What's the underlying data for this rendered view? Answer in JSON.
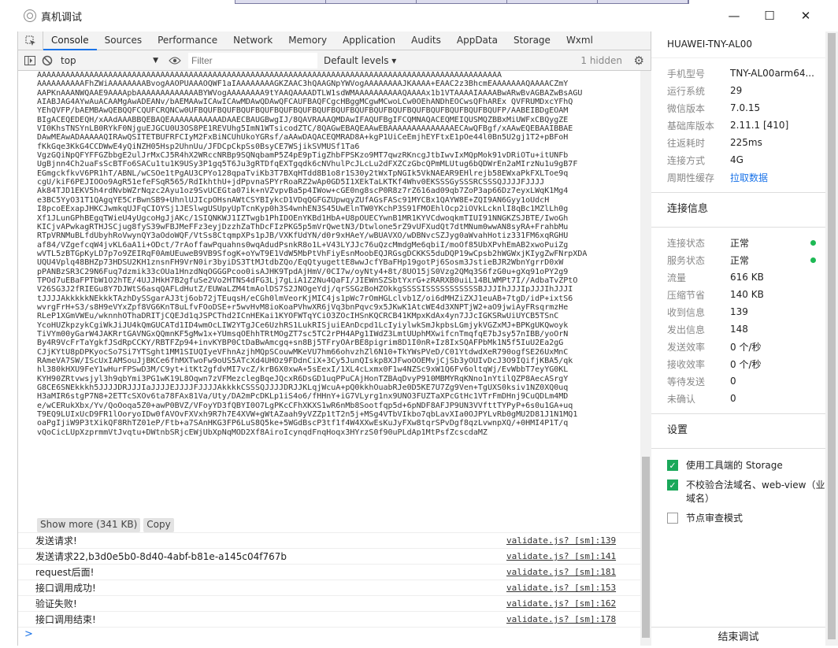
{
  "window": {
    "title": "真机调试",
    "minimize": "—",
    "maximize": "☐",
    "close": "✕"
  },
  "tabs": [
    "Console",
    "Sources",
    "Performance",
    "Network",
    "Memory",
    "Application",
    "Audits",
    "AppData",
    "Storage",
    "Wxml"
  ],
  "toolbar": {
    "context": "top",
    "filter_placeholder": "Filter",
    "levels": "Default levels ▾",
    "hidden": "1 hidden"
  },
  "blob": {
    "lines": [
      "AAAAAAAAAAAAAAAAAAAAAAAAAAAAAAAAAAAAAAAAAAAAAAAAAAAAAAAAAAAAAAAAAAAAAAAAAAAAAAAAAAAAAAAAAAAAAAAAAA",
      "AAAAAAAAAAFhZWiAAAAAAAABvogAAOPUAAAOQWF1aIAAAAAAAAGKZAAC3hQAAGNpYWVogAAAAAAAAJKAAAA+EAAC2z3BhcmEAAAAAAAQAAAACZmY",
      "AAPKnAAANWQAAE9AAAApbAAAAAAAAAAAAABYWVogAAAAAAAA9tYAAQAAAADTLW1sdWMAAAAAAAAAAQAAAAx1b1VTAAAAIAAAABwARwBvAGBAZwBsAGU",
      "AIABJAG4AYwAuACAAMgAwADEANv/bAEMAAwICAwICAwMDAwQDAwQFCAUFBAQFCgcHBggMCgwMCwoLCw0OEhANDhEOCwsQFhAREx QVFRUMDxcYFhQ",
      "YEhQVFP/bAEMBAwQEBQQFCQUFCRQNCw0UFBQUFBQUFBQUFBQUFBQUFBQUFBQUFBQUFBQUFBQUFBQUFBQUFBQUFBQUFBQUFBQUFP/AABEIBDgEOAM",
      "BIgACEQEDEQH/xAAdAAABBQEBAQEAAAAAAAAAAADAAECBAUGBwgIJ/8QAVRAAAQMDAwIFAQUFBgIFCQMNAQACEQMEIQUSMQZBBxMiUWFxCBQygZE",
      "VI0KhsTNSYnLB0RYkF0NjguEJGCU0U3OS8PE1REVUhg5ImN1WTsicodZTC/8QAGwEBAQEAAwEBAAAAAAAAAAAAAAECAwQFBgf/xAAwEQEBAAIBBAE",
      "DAwMEAwADAAAAAQIRAwQSITETBUFRFCIyM2FxBiNCUhUkoYGRsf/aAAwDAQACEQMRAD8A+kgP1UiCeEmjhEYFtxE1pOe44l0Bn5U2gj1T2+pBFoH",
      "fKkGqe3KkG4CCDWwE4yQiNZH05Hsp2UhnUu/JFDCpCkpSs0BsyCE7WSjikSVMUSf1Ta6",
      "VgzGQiNpQFYFFGZbbgE2ulJrMxCJ5R4hX2WRccNRBp9SQNqbamP5Z4pE9pTigZhbFPSKzo9MT7qwzRKncgJtbIwvIxMQpMok91vDRiOTu+itUNFb",
      "UgBjnn4Ch2uaFsScBTFo6SACu1tu1K9USy3P1gq5T6Ju3gRTDfqEXTgqdk6cNVhulPcJLcLu2dFXZCzGbcQPmMLUtug6bQDWrEn2aMIrzNu1u9gB7F",
      "EGmgckfkvV6PR1hT/ABNL/wCSOe1tPgAU3CPYo128qpaTviKb3T7BXqHTdd8B1o8r1S30y2tWxTpNGIk5VkNAEAR9EHlrejb58EWxaPkFXLToe9q",
      "cgU/kiF6PEJIOOo9AgR51efeFSqR565/RdIkhthU+jdPpvnaSPYrRoaRZ2wAp0GD5I1XEkTaLKTKf4Whv0EKSSSGySSSRCSSSQJJJJFJJJJ",
      "Ak84TJD1EKV5h4rdNvbWZrNqzc2Ayu1oz9SvUCEGta07ik+nVZvpvBa5p4IWow+cGE0ng8scP0R8z7rZ616ad09qb7ZoP3ap66Dz7eyxLWqK1Mg4",
      "e3BC5YyO31T1QAgqYE5CrBwnSB9+UhnlUJIcpOHsnAWtCSYBIykcD1VDqQGFGZUpwqyZUfAGsFASc91MYCBx1QAYW8E+ZQI9AN6Gyy1oUdcH",
      "I8pcoEExapJHKCJwmkqUJFqCIOYSj1JESlwgUSUpyUpTcnKyp0h3S4wnhEN3S45UwElnTW0YKchP3S91FMOEhlOcp2iOVkLcknlI8qBc1MZlLh0g",
      "Xf1JLunGPhBEgqTWieU4yUgcoHgJjAKc/1SIQNKWJ1IZTwgb1PhIDOEnYKBd1HbA+U8pOUECYwnB1MR1KYVCdwoqkmTIUI91NNGKZSJBTE/IwoGh",
      "KICjvAPwkagRTHJSCjug8fyS39wFBJMeFFz3eyjDzzhZaThDcFIzPKG5p5mVrQwetN3/Dtwlone5rZ9vUFXudQt7dtMNum0wwAN8syRA+FrahbMu",
      "RTpVRNMuBLfdUbyhRoVwynQY3aOdoWQF/VtSs8CtqmpXPs1pJB/VXKfUdYN/d0r9xHAeY/wBUAVXO/wDBNvcSZJyg0aWvahHotiz331FM6xqRGHU",
      "af84/VZgefcqW4jvKL6aA1i+ODct/7rAoffawPquahns0wqAdudPsnkR8o1L+V43LYJJc76uQzcMmdgMe6qbiI/moOf85UbXPvhEmAB2xwoPuiZg",
      "wVTL5zBTGpKyLD7p7o9ZEIRqF0AmUEuweB9VB9SfogK+oYwT9E1VdW5MbPtVhFiyEsnMoobEQJRGsgDCKKS5duDQP19wCpsb2hWGWxjKIygZwFNrpXDA",
      "UQU4Vplq48BHZp73HDSU2KH1znsnFH9VrN0ir3byiDS3TtMJtdbZQo/EqQtyugettE8wwJcfYBaFHp19gotPj6Sosm3JstieBJR2WbnYgrrD0xW",
      "pPANBzSR3C29N6Fuq7dzmik33cOUa1HnzdNqOGGGPcoo0isAJHK9TpdAjHmV/0CI7w/oyNty4+8t/8UO15jS0Vzg2QMq3S6fzG0u+gXq91oPY2g9",
      "TPOd7uEBaFPTbW1O2hTE/4UJJHkH7B2gfuSe2Vo2HTNS4dFG3Lj7gLiA1Z2Nu4QaFI/JIEWnSZSbtYxrG+zRARXB0uiL14BLWMPt7I//AdbaTvZPtO",
      "V26SG3J2fRIEGu8Y7DJWtS6asqQAFLdHutZ/EUWaLZM4tmAolDS7S2JNOgeYdj/qrSSGzBoHZOkkgSSSSISSSSSSSSSSSBJJJIhJJJIpJJJIhJJJI",
      "tJJJJAkkkkkNEkkkTAzhDySSgarAJ3tj6ob72jTEuqsH/eCGh0lmVeorKjMIC4js1pWc7rOmHGLclvb1Z/oi6dMHZiZXJ1euAB+7tgD/idP+ixtS6",
      "wvrgFrH+S3/s8H9eVYxZpf8VG6KnT8uLfvFOoDSE+r5wvHvM8ioKoaPVhwXR6jVq3bnPqvc9x5JKwK1AtcWE4d3XNPTjW2+aO9jwiAyFRsqrmzHe",
      "RLeP1XGmVWEu/wknnhOThaDRITjCQEJd1qJSPCThd2ICnHEKai1KYOFWTqYCiO3ZOcIHSnKQCRCB41KMpxKdAx4yn7JJcIGKSRwUiUYCB5TSnC",
      "YcoHUZkpzykCgiWkJiJU4kQmGUCATd1ID4wmOcLIW2YTgJCe6UzhRS1LukRISjuiEAnDcpd1LcIyiylwkSmJkpbsLGmjykVGZxMJ+BPKgUKQwoyk",
      "TiVYm00yGarW4JAKRrtGAVNGxQQmnKF5gMw1x+YUmsqOEhhTRtMOgZT7sc5TC2rPH4APg1IWdZ3LmtUUphMXwifcnTmqfqE7bJsy57nIBB/yoOrN",
      "By4R9VcFrTaYgkfJSdRpCCKY/RBTFZp94+invKYBP0CtDaBwAmcgq+sn8Bj5TFryOArBE8pigrim8D1I0nR+Iz8IxSQAFPbMk1N5f5IuU2Ea2gG",
      "CJjKYtU8pDPKyocSo7Si7YTSght1MM1SIUQIyeVFhnAzjhMQpSCouwMKeVU7hm66ohvzhZl6N10+TkYWsPVeD/C01YtdwdXeR790ogfSE26UxMnC",
      "RAmeVA7SW/IScUxIAMSouJjBKCe6fhMXTwoFw9oUS5ATcXd4UHOz9FDdnCiX+3Cy5JunQIskp8XJFwoOOEMvjCjSb3yOUIvDcJ3O9IQifjKBA5/qk",
      "hl380kHXU9FeY1wHurFPSwD3M/C9yt+itKt2gfdvMI7vcZ/krB6X0xwA+5sEexI/1XL4cLxmx0F1w4NZSc9xW1Q6Fv6oltqWj/EvWbbT7eyYG0KL",
      "KYH90ZRtvwsjyl3h9qbYmi3PG1wK19L8Oqwn7zVFMezclegBqeJQcxR6DsGD1uqPPuCAjHonTZBAqDvyP910MBMYRqKNno1nYtilQZP8AecASrgY",
      "G8CE6SNEkkkh5JJJJDRJJJIaJJJJEJJJJFJJJJAkkkkCSSSQJJJJDRJJKLqjWcuA+pQ0kkhOuabRJe0D5KE7U7Zg9Ven+TgUXS0ksiv1NZ0XQ0uq",
      "H3aMIR6stgP7N8+2ETTcSXOv6ta78FAx81Va/Uty/DA2mPcDKLp1iS4o6/fHHnY+iG7VLyrg1nx9UNO3FUZTaXPcGtHc1VTrFmDHnj9CuQDLm4MD",
      "e/wCERukXbx/Yv/QoOoqa5Z0+awP0BVZ/VFoyYD3fQBYI0O7LgPKcCFhXKXS1wR6nMb8Sootfqp5d+6pNDF8AFJP9UN3VVfttTYPyP+6s0u1GA+uq",
      "T9EQ9LUIxUcD9FR1lOoryoIDw0fAVOvFXVxh9R7h7E4XVW+gWtAZaah9yVZZp1tT2n5j+MSg4VTbVIkbo7qbLavXIa0OJPYLvRb0gMU2D81J1N1MQ1",
      "oaPgIjiW9P3tXikQF8RhTZ01eP/Ftb+a7SAnHKG3FP6LuS8Q5ke+5WGdBscP3tf1f4W4XXwEsKuJyFXw8tqrSPvDgf8qzLvwnpXQ/+0HMI4P1T/q",
      "vQoCicLUpXzprmmVtJvqtu+DWtnbSRjcEWjUbXpNqMOD2Xf8AiroIcynqdFnqHoqx3HYrzS0f90uPLdAp1MtPsfZcscdaMZ"
    ],
    "show_more": "Show more (341 KB)",
    "copy": "Copy"
  },
  "logs": [
    {
      "msg": "发送请求!",
      "src": "validate.js? [sm]:139"
    },
    {
      "msg": "发送请求22,b3d0e5b0-8d40-4abf-b81e-a145c04f767b",
      "src": "validate.js? [sm]:141"
    },
    {
      "msg": "request后面!",
      "src": "validate.js? [sm]:181"
    },
    {
      "msg": "接口调用成功!",
      "src": "validate.js? [sm]:153"
    },
    {
      "msg": "验证失败!",
      "src": "validate.js? [sm]:162"
    },
    {
      "msg": "接口调用结束!",
      "src": "validate.js? [sm]:178"
    }
  ],
  "prompt": ">",
  "panel": {
    "device": "HUAWEI-TNY-AL00",
    "info": [
      {
        "k": "手机型号",
        "v": "TNY-AL00arm64..."
      },
      {
        "k": "运行系统",
        "v": "29"
      },
      {
        "k": "微信版本",
        "v": "7.0.15"
      },
      {
        "k": "基础库版本",
        "v": "2.11.1 [410]"
      },
      {
        "k": "往返耗时",
        "v": "225ms"
      },
      {
        "k": "连接方式",
        "v": "4G"
      },
      {
        "k": "周期性缓存",
        "v": "拉取数据"
      }
    ],
    "conn_title": "连接信息",
    "conn": [
      {
        "k": "连接状态",
        "v": "正常",
        "dot": true
      },
      {
        "k": "服务状态",
        "v": "正常",
        "dot": true
      },
      {
        "k": "流量",
        "v": "616 KB"
      },
      {
        "k": "压缩节省",
        "v": "140 KB"
      },
      {
        "k": "收到信息",
        "v": "139"
      },
      {
        "k": "发出信息",
        "v": "148"
      },
      {
        "k": "发送效率",
        "v": "0 个/秒"
      },
      {
        "k": "接收效率",
        "v": "0 个/秒"
      },
      {
        "k": "等待发送",
        "v": "0"
      },
      {
        "k": "未确认",
        "v": "0"
      }
    ],
    "settings_title": "设置",
    "settings": [
      {
        "label": "使用工具端的 Storage",
        "checked": true
      },
      {
        "label": "不校验合法域名、web-view（业务域名）",
        "checked": true
      },
      {
        "label": "节点审查模式",
        "checked": false
      }
    ],
    "end_debug": "结束调试"
  },
  "colors": {
    "accent": "#1a73e8",
    "ok": "#1db954",
    "check": "#1aa85a"
  }
}
